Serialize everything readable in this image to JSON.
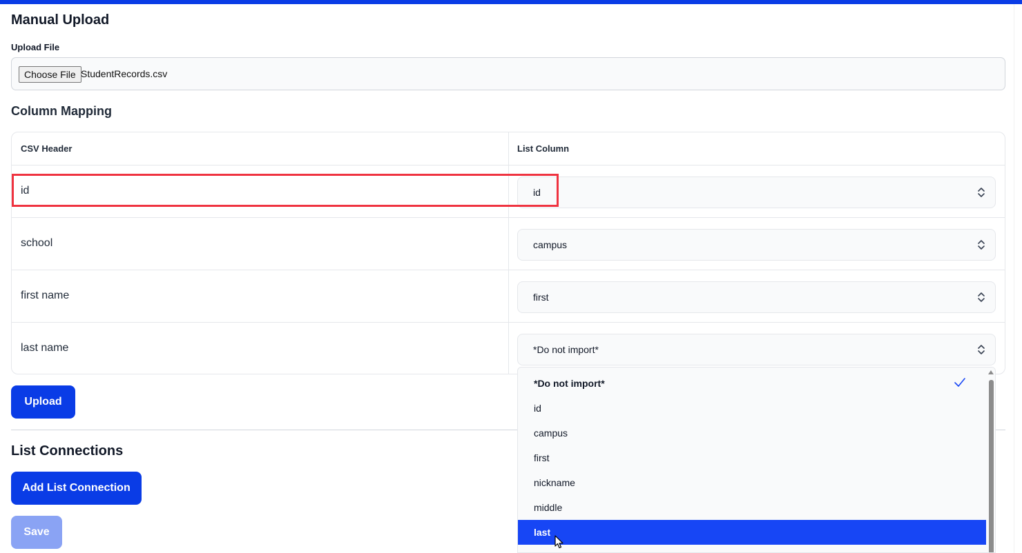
{
  "manual_upload": {
    "title": "Manual Upload",
    "upload_file_label": "Upload File",
    "choose_file_button": "Choose File",
    "file_name": "StudentRecords.csv"
  },
  "column_mapping": {
    "title": "Column Mapping",
    "headers": {
      "csv_header": "CSV Header",
      "list_column": "List Column"
    },
    "rows": [
      {
        "csv_header": "id",
        "list_column": "id"
      },
      {
        "csv_header": "school",
        "list_column": "campus"
      },
      {
        "csv_header": "first name",
        "list_column": "first"
      },
      {
        "csv_header": "last name",
        "list_column": "*Do not import*"
      }
    ],
    "upload_button": "Upload"
  },
  "dropdown": {
    "options": [
      "*Do not import*",
      "id",
      "campus",
      "first",
      "nickname",
      "middle",
      "last"
    ],
    "selected": "*Do not import*",
    "hovered": "last"
  },
  "list_connections": {
    "title": "List Connections",
    "add_button": "Add List Connection",
    "save_button": "Save"
  },
  "colors": {
    "primary": "#0a3ce6",
    "primary_disabled": "#8aa3f4",
    "hover_option": "#1746f5",
    "highlight_box": "#ef3340"
  },
  "icons": {
    "select_chevron": "chevron-up-down-icon",
    "selected_check": "check-icon",
    "cursor": "mouse-pointer-icon"
  }
}
